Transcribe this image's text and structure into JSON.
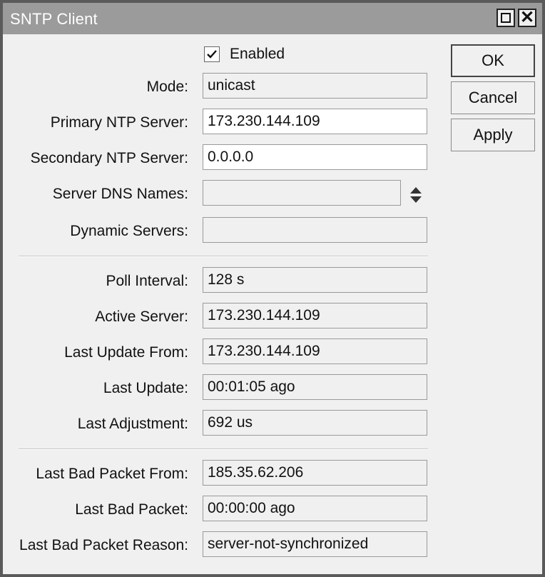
{
  "window": {
    "title": "SNTP Client"
  },
  "buttons": {
    "ok": "OK",
    "cancel": "Cancel",
    "apply": "Apply"
  },
  "form": {
    "enabled": {
      "label": "Enabled",
      "checked": true
    },
    "mode": {
      "label": "Mode:",
      "value": "unicast"
    },
    "primary_ntp_server": {
      "label": "Primary NTP Server:",
      "value": "173.230.144.109"
    },
    "secondary_ntp_server": {
      "label": "Secondary NTP Server:",
      "value": "0.0.0.0"
    },
    "server_dns_names": {
      "label": "Server DNS Names:",
      "value": ""
    },
    "dynamic_servers": {
      "label": "Dynamic Servers:",
      "value": ""
    },
    "poll_interval": {
      "label": "Poll Interval:",
      "value": "128 s"
    },
    "active_server": {
      "label": "Active Server:",
      "value": "173.230.144.109"
    },
    "last_update_from": {
      "label": "Last Update From:",
      "value": "173.230.144.109"
    },
    "last_update": {
      "label": "Last Update:",
      "value": "00:01:05 ago"
    },
    "last_adjustment": {
      "label": "Last Adjustment:",
      "value": "692 us"
    },
    "last_bad_packet_from": {
      "label": "Last Bad Packet From:",
      "value": "185.35.62.206"
    },
    "last_bad_packet": {
      "label": "Last Bad Packet:",
      "value": "00:00:00 ago"
    },
    "last_bad_packet_reason": {
      "label": "Last Bad Packet Reason:",
      "value": "server-not-synchronized"
    }
  },
  "icons": {
    "checkbox": "checkmark-icon",
    "updown": "up-down-arrows-icon",
    "maximize": "maximize-icon",
    "close": "close-icon"
  }
}
